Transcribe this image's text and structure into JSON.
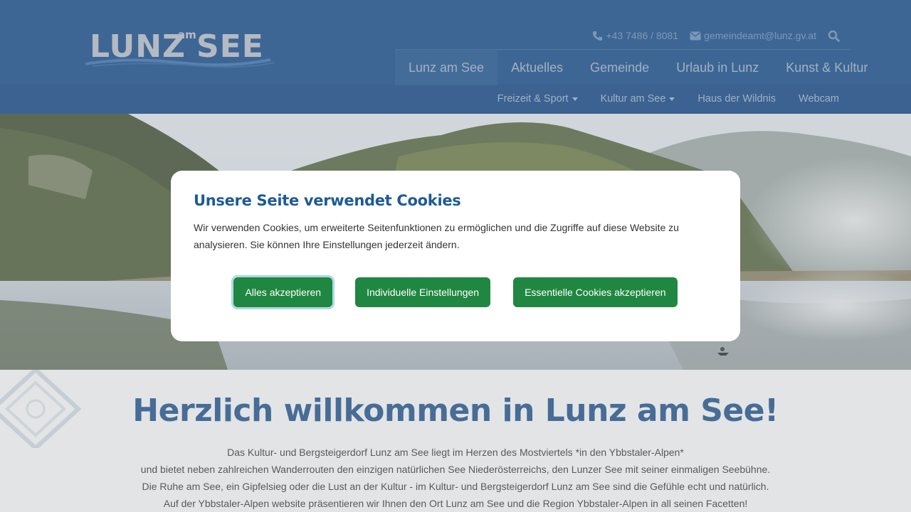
{
  "header": {
    "logo": "LUNZ am SEE",
    "logo_parts": {
      "main": "LUNZ",
      "small": "am",
      "second": "SEE"
    },
    "contact": {
      "phone": "+43 7486 / 8081",
      "email": "gemeindeamt@lunz.gv.at",
      "phone_icon": "phone-icon",
      "email_icon": "envelope-icon",
      "search_icon": "search-icon"
    },
    "main_nav": [
      {
        "label": "Lunz am See",
        "active": true
      },
      {
        "label": "Aktuelles"
      },
      {
        "label": "Gemeinde"
      },
      {
        "label": "Urlaub in Lunz"
      },
      {
        "label": "Kunst & Kultur"
      }
    ],
    "sub_nav": [
      {
        "label": "Freizeit & Sport",
        "dropdown": true
      },
      {
        "label": "Kultur am See",
        "dropdown": true
      },
      {
        "label": "Haus der Wildnis"
      },
      {
        "label": "Webcam"
      }
    ]
  },
  "content": {
    "heading": "Herzlich willkommen in Lunz am See!",
    "paragraph": [
      "Das Kultur- und Bergsteigerdorf Lunz am See liegt im Herzen des Mostviertels *in den Ybbstaler-Alpen*",
      "und bietet neben zahlreichen Wanderrouten den einzigen natürlichen See Niederösterreichs, den Lunzer See mit seiner einmaligen Seebühne.",
      "Die Ruhe am See, ein Gipfelsieg oder die Lust an der Kultur - im Kultur- und Bergsteigerdorf Lunz am See sind die Gefühle echt und natürlich.",
      "Auf der Ybbstaler-Alpen website präsentieren wir Ihnen den Ort Lunz am See und die Region Ybbstaler-Alpen in all seinen Facetten!"
    ]
  },
  "cookie_modal": {
    "title": "Unsere Seite verwendet Cookies",
    "text": "Wir verwenden Cookies, um erweiterte Seitenfunktionen zu ermöglichen und die Zugriffe auf diese Website zu analysieren. Sie können Ihre Einstellungen jederzeit ändern.",
    "buttons": {
      "accept_all": "Alles akzeptieren",
      "individual": "Individuelle Einstellungen",
      "essential": "Essentielle Cookies akzeptieren"
    }
  },
  "colors": {
    "header": "#1f5c9e",
    "heading": "#1b4f8a",
    "button": "#1f8741",
    "modal_title": "#1e5a96"
  }
}
